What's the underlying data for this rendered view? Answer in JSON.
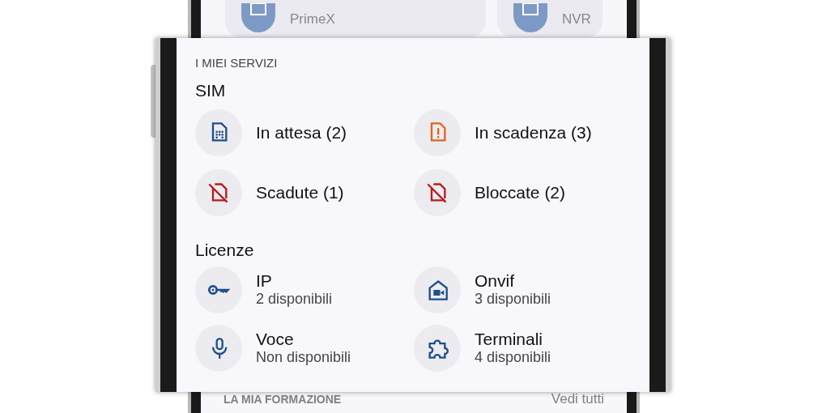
{
  "background_screen": {
    "cards": [
      {
        "subtitle": "PrimeX"
      },
      {
        "subtitle": "NVR"
      }
    ],
    "section": {
      "title": "LA MIA FORMAZIONE",
      "link": "Vedi tutti"
    }
  },
  "services": {
    "title": "I MIEI SERVIZI",
    "groups": [
      {
        "title": "SIM",
        "items": [
          {
            "kind": "sim",
            "color": "#1f4e8c",
            "label": "In attesa (2)"
          },
          {
            "kind": "sim-alert",
            "color": "#e0661c",
            "label": "In scadenza (3)"
          },
          {
            "kind": "sim-off",
            "color": "#b71c1c",
            "label": "Scadute (1)"
          },
          {
            "kind": "sim-off",
            "color": "#b71c1c",
            "label": "Bloccate (2)"
          }
        ]
      },
      {
        "title": "Licenze",
        "items": [
          {
            "kind": "key",
            "color": "#1f4e8c",
            "label": "IP",
            "detail": "2 disponibili"
          },
          {
            "kind": "home-camera",
            "color": "#1f4e8c",
            "label": "Onvif",
            "detail": "3 disponibili"
          },
          {
            "kind": "mic",
            "color": "#1f4e8c",
            "label": "Voce",
            "detail": "Non disponibili"
          },
          {
            "kind": "puzzle",
            "color": "#1f4e8c",
            "label": "Terminali",
            "detail": "4 disponibili"
          }
        ]
      }
    ]
  }
}
